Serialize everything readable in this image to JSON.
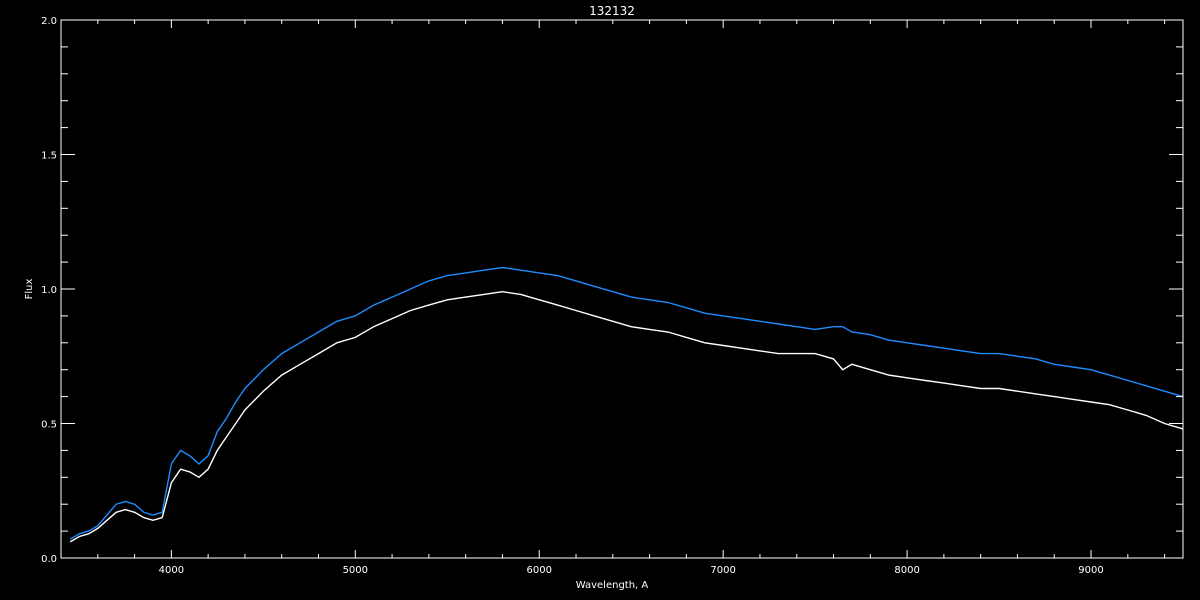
{
  "chart_data": {
    "type": "line",
    "title": "132132",
    "xlabel": "Wavelength, A",
    "ylabel": "Flux",
    "xlim": [
      3400,
      9500
    ],
    "ylim": [
      0.0,
      2.0
    ],
    "x_ticks": [
      4000,
      5000,
      6000,
      7000,
      8000,
      9000
    ],
    "x_tick_labels": [
      "4000",
      "5000",
      "6000",
      "7000",
      "8000",
      "9000"
    ],
    "y_ticks": [
      0.0,
      0.5,
      1.0,
      1.5,
      2.0
    ],
    "y_tick_labels": [
      "0.0",
      "0.5",
      "1.0",
      "1.5",
      "2.0"
    ],
    "grid": false,
    "background_color": "#000000",
    "axis_color": "#ffffff",
    "series": [
      {
        "color": "#ffffff",
        "x": [
          3450,
          3500,
          3550,
          3600,
          3650,
          3700,
          3750,
          3800,
          3850,
          3900,
          3950,
          4000,
          4050,
          4100,
          4150,
          4200,
          4250,
          4300,
          4350,
          4400,
          4500,
          4600,
          4700,
          4800,
          4900,
          5000,
          5100,
          5200,
          5300,
          5400,
          5500,
          5600,
          5700,
          5800,
          5900,
          6000,
          6100,
          6200,
          6300,
          6400,
          6500,
          6600,
          6700,
          6800,
          6900,
          7000,
          7100,
          7200,
          7300,
          7400,
          7500,
          7600,
          7650,
          7700,
          7800,
          7900,
          8000,
          8100,
          8200,
          8300,
          8400,
          8500,
          8600,
          8700,
          8800,
          8900,
          9000,
          9100,
          9200,
          9300,
          9400,
          9500
        ],
        "y": [
          0.06,
          0.08,
          0.09,
          0.11,
          0.14,
          0.17,
          0.18,
          0.17,
          0.15,
          0.14,
          0.15,
          0.28,
          0.33,
          0.32,
          0.3,
          0.33,
          0.4,
          0.45,
          0.5,
          0.55,
          0.62,
          0.68,
          0.72,
          0.76,
          0.8,
          0.82,
          0.86,
          0.89,
          0.92,
          0.94,
          0.96,
          0.97,
          0.98,
          0.99,
          0.98,
          0.96,
          0.94,
          0.92,
          0.9,
          0.88,
          0.86,
          0.85,
          0.84,
          0.82,
          0.8,
          0.79,
          0.78,
          0.77,
          0.76,
          0.76,
          0.76,
          0.74,
          0.7,
          0.72,
          0.7,
          0.68,
          0.67,
          0.66,
          0.65,
          0.64,
          0.63,
          0.63,
          0.62,
          0.61,
          0.6,
          0.59,
          0.58,
          0.57,
          0.55,
          0.53,
          0.5,
          0.48
        ]
      },
      {
        "color": "#1e8cff",
        "x": [
          3450,
          3500,
          3550,
          3600,
          3650,
          3700,
          3750,
          3800,
          3850,
          3900,
          3950,
          4000,
          4050,
          4100,
          4150,
          4200,
          4250,
          4300,
          4350,
          4400,
          4500,
          4600,
          4700,
          4800,
          4900,
          5000,
          5100,
          5200,
          5300,
          5400,
          5500,
          5600,
          5700,
          5800,
          5900,
          6000,
          6100,
          6200,
          6300,
          6400,
          6500,
          6600,
          6700,
          6800,
          6900,
          7000,
          7100,
          7200,
          7300,
          7400,
          7500,
          7600,
          7650,
          7700,
          7800,
          7900,
          8000,
          8100,
          8200,
          8300,
          8400,
          8500,
          8600,
          8700,
          8800,
          8900,
          9000,
          9100,
          9200,
          9300,
          9400,
          9500
        ],
        "y": [
          0.07,
          0.09,
          0.1,
          0.12,
          0.16,
          0.2,
          0.21,
          0.2,
          0.17,
          0.16,
          0.17,
          0.35,
          0.4,
          0.38,
          0.35,
          0.38,
          0.47,
          0.52,
          0.58,
          0.63,
          0.7,
          0.76,
          0.8,
          0.84,
          0.88,
          0.9,
          0.94,
          0.97,
          1.0,
          1.03,
          1.05,
          1.06,
          1.07,
          1.08,
          1.07,
          1.06,
          1.05,
          1.03,
          1.01,
          0.99,
          0.97,
          0.96,
          0.95,
          0.93,
          0.91,
          0.9,
          0.89,
          0.88,
          0.87,
          0.86,
          0.85,
          0.86,
          0.86,
          0.84,
          0.83,
          0.81,
          0.8,
          0.79,
          0.78,
          0.77,
          0.76,
          0.76,
          0.75,
          0.74,
          0.72,
          0.71,
          0.7,
          0.68,
          0.66,
          0.64,
          0.62,
          0.6
        ]
      }
    ]
  }
}
